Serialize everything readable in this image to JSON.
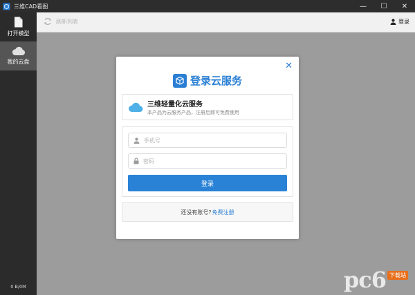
{
  "window": {
    "title": "三维CAD看图",
    "controls": {
      "minimize": "—",
      "maximize": "☐",
      "close": "✕"
    }
  },
  "sidebar": {
    "items": [
      {
        "label": "打开模型",
        "icon": "file-icon",
        "active": false
      },
      {
        "label": "我的云盘",
        "icon": "cloud-icon",
        "active": true
      }
    ],
    "storage": "0 B/0M"
  },
  "toolbar": {
    "refresh_label": "刷新列表",
    "login_label": "登录"
  },
  "modal": {
    "title": "登录云服务",
    "close": "✕",
    "info": {
      "title": "三维轻量化云服务",
      "desc": "本产品为云服务产品，注册后即可免费使用"
    },
    "phone_placeholder": "手机号",
    "password_placeholder": "密码",
    "login_button": "登录",
    "register_prompt": "还没有账号?",
    "register_link": "免费注册"
  },
  "watermark": {
    "text": "pc6",
    "tag": "下载站"
  },
  "colors": {
    "accent": "#2a82d6",
    "sidebar_bg": "#2b2b2b",
    "content_bg": "#9c9c9c"
  }
}
